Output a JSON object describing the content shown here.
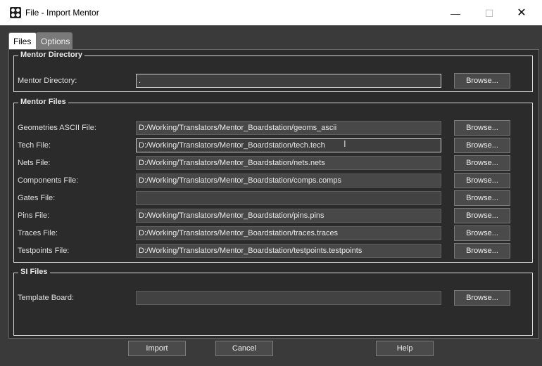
{
  "window": {
    "title": "File - Import Mentor",
    "minimize_glyph": "—",
    "maximize_glyph": "☐",
    "close_glyph": "✕"
  },
  "tabs": [
    {
      "label": "Files",
      "selected": true
    },
    {
      "label": "Options",
      "selected": false
    }
  ],
  "mentor_directory": {
    "group_title": "Mentor Directory",
    "label": "Mentor Directory:",
    "value": ".",
    "browse_label": "Browse..."
  },
  "mentor_files": {
    "group_title": "Mentor Files",
    "rows": [
      {
        "label": "Geometries ASCII File:",
        "value": "D:/Working/Translators/Mentor_Boardstation/geoms_ascii",
        "browse": "Browse..."
      },
      {
        "label": "Tech File:",
        "value": "D:/Working/Translators/Mentor_Boardstation/tech.tech",
        "browse": "Browse..."
      },
      {
        "label": "Nets File:",
        "value": "D:/Working/Translators/Mentor_Boardstation/nets.nets",
        "browse": "Browse..."
      },
      {
        "label": "Components File:",
        "value": "D:/Working/Translators/Mentor_Boardstation/comps.comps",
        "browse": "Browse..."
      },
      {
        "label": "Gates File:",
        "value": "",
        "browse": "Browse..."
      },
      {
        "label": "Pins File:",
        "value": "D:/Working/Translators/Mentor_Boardstation/pins.pins",
        "browse": "Browse..."
      },
      {
        "label": "Traces File:",
        "value": "D:/Working/Translators/Mentor_Boardstation/traces.traces",
        "browse": "Browse..."
      },
      {
        "label": "Testpoints File:",
        "value": "D:/Working/Translators/Mentor_Boardstation/testpoints.testpoints",
        "browse": "Browse..."
      }
    ]
  },
  "si_files": {
    "group_title": "SI Files",
    "label": "Template Board:",
    "value": "",
    "browse_label": "Browse..."
  },
  "buttons": {
    "import": "Import",
    "cancel": "Cancel",
    "help": "Help"
  }
}
